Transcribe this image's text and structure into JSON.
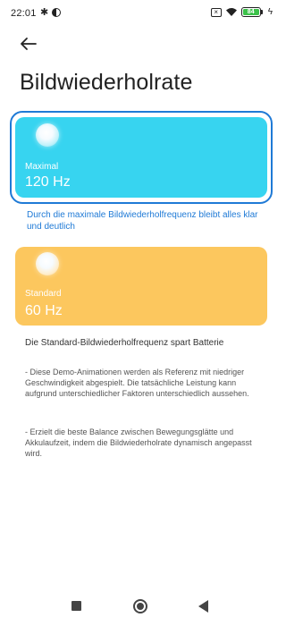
{
  "status_bar": {
    "time": "22:01",
    "battery_level": "84",
    "left_icons": [
      "gear-icon",
      "half-circle-icon"
    ],
    "right_icons": [
      "dnd-icon",
      "wifi-icon",
      "battery-icon",
      "charging-icon"
    ]
  },
  "header": {
    "back_icon": "arrow-left-icon",
    "title": "Bildwiederholrate"
  },
  "options": {
    "maximal": {
      "label": "Maximal",
      "value": "120 Hz",
      "color": "#37d4f0",
      "selected": true,
      "description": "Durch die maximale Bildwiederholfrequenz bleibt alles klar und deutlich"
    },
    "standard": {
      "label": "Standard",
      "value": "60 Hz",
      "color": "#fcc75e",
      "selected": false,
      "description": "Die Standard-Bildwiederholfrequenz spart Batterie"
    }
  },
  "notes": [
    "- Diese Demo-Animationen werden als Referenz mit niedriger Geschwindigkeit abgespielt. Die tatsächliche Leistung kann aufgrund unterschiedlicher Faktoren unterschiedlich aussehen.",
    "- Erzielt die beste Balance zwischen Bewegungsglätte und Akkulaufzeit, indem die Bildwiederholrate dynamisch angepasst wird."
  ],
  "accent_color": "#1f7ad6",
  "nav_bar": {
    "buttons": [
      "recents-square-icon",
      "home-circle-icon",
      "back-triangle-icon"
    ]
  }
}
